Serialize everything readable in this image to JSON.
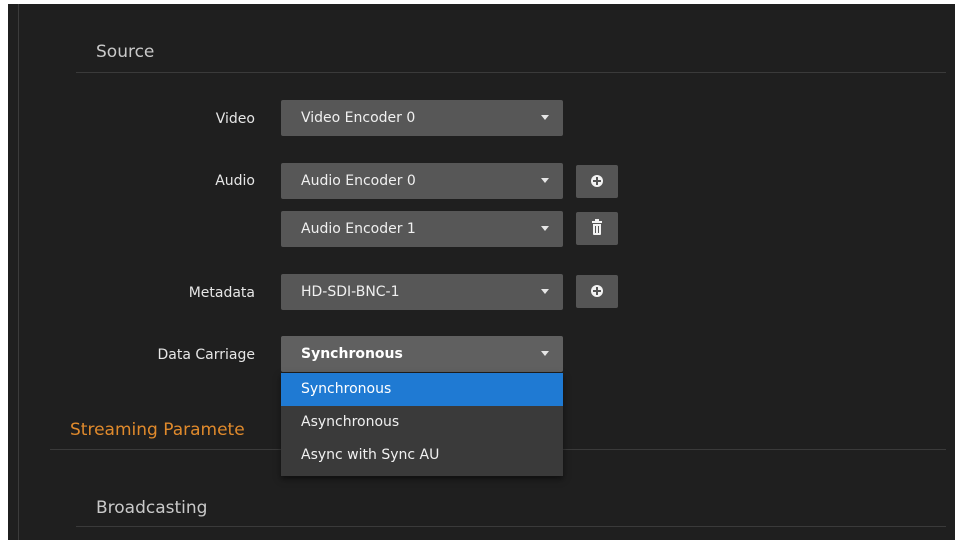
{
  "sections": {
    "source": "Source",
    "streaming": "Streaming Paramete",
    "broadcasting": "Broadcasting"
  },
  "fields": {
    "video": {
      "label": "Video",
      "value": "Video Encoder 0"
    },
    "audio": {
      "label": "Audio",
      "values": [
        "Audio Encoder 0",
        "Audio Encoder 1"
      ]
    },
    "metadata": {
      "label": "Metadata",
      "value": "HD-SDI-BNC-1"
    },
    "data_carriage": {
      "label": "Data Carriage",
      "value": "Synchronous",
      "options": [
        "Synchronous",
        "Asynchronous",
        "Async with Sync AU"
      ]
    }
  },
  "colors": {
    "background": "#1f1f1f",
    "accent_orange": "#e08a2c",
    "selected_blue": "#1f7ad3"
  },
  "icons": {
    "add": "plus-circle-icon",
    "delete": "trash-icon",
    "caret": "caret-down-icon"
  }
}
